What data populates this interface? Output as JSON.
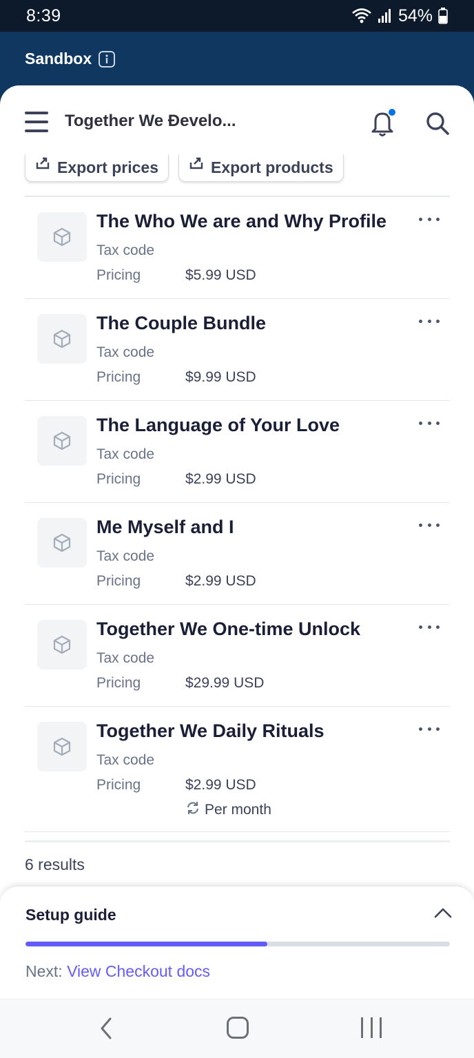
{
  "status_bar": {
    "time": "8:39",
    "battery": "54%"
  },
  "sandbox": {
    "label": "Sandbox"
  },
  "header": {
    "account_name": "Together We Ɖevelo..."
  },
  "toolbar": {
    "export_prices": "Export prices",
    "export_products": "Export products"
  },
  "products": [
    {
      "name": "The Who We are and Why Profile",
      "tax_label": "Tax code",
      "pricing_label": "Pricing",
      "price": "$5.99 USD"
    },
    {
      "name": "The Couple Bundle",
      "tax_label": "Tax code",
      "pricing_label": "Pricing",
      "price": "$9.99 USD"
    },
    {
      "name": "The Language of Your Love",
      "tax_label": "Tax code",
      "pricing_label": "Pricing",
      "price": "$2.99 USD"
    },
    {
      "name": "Me Myself and I",
      "tax_label": "Tax code",
      "pricing_label": "Pricing",
      "price": "$2.99 USD"
    },
    {
      "name": "Together We One-time Unlock",
      "tax_label": "Tax code",
      "pricing_label": "Pricing",
      "price": "$29.99 USD"
    },
    {
      "name": "Together We Daily Rituals",
      "tax_label": "Tax code",
      "pricing_label": "Pricing",
      "price": "$2.99 USD",
      "recurrence": "Per month"
    }
  ],
  "results": {
    "count_text": "6 results"
  },
  "setup_guide": {
    "title": "Setup guide",
    "progress_fraction": 0.57,
    "next_prefix": "Next: ",
    "next_link": "View Checkout docs"
  },
  "colors": {
    "sandbox_bar": "#0f3760",
    "accent": "#635bff",
    "notification_dot": "#0073e6"
  },
  "icons": [
    "wifi-icon",
    "signal-icon",
    "battery-icon",
    "info-icon",
    "menu-icon",
    "bell-icon",
    "search-icon",
    "export-icon",
    "product-box-icon",
    "more-icon",
    "recurring-icon",
    "chevron-up-icon",
    "back-icon",
    "home-icon",
    "recent-apps-icon"
  ]
}
